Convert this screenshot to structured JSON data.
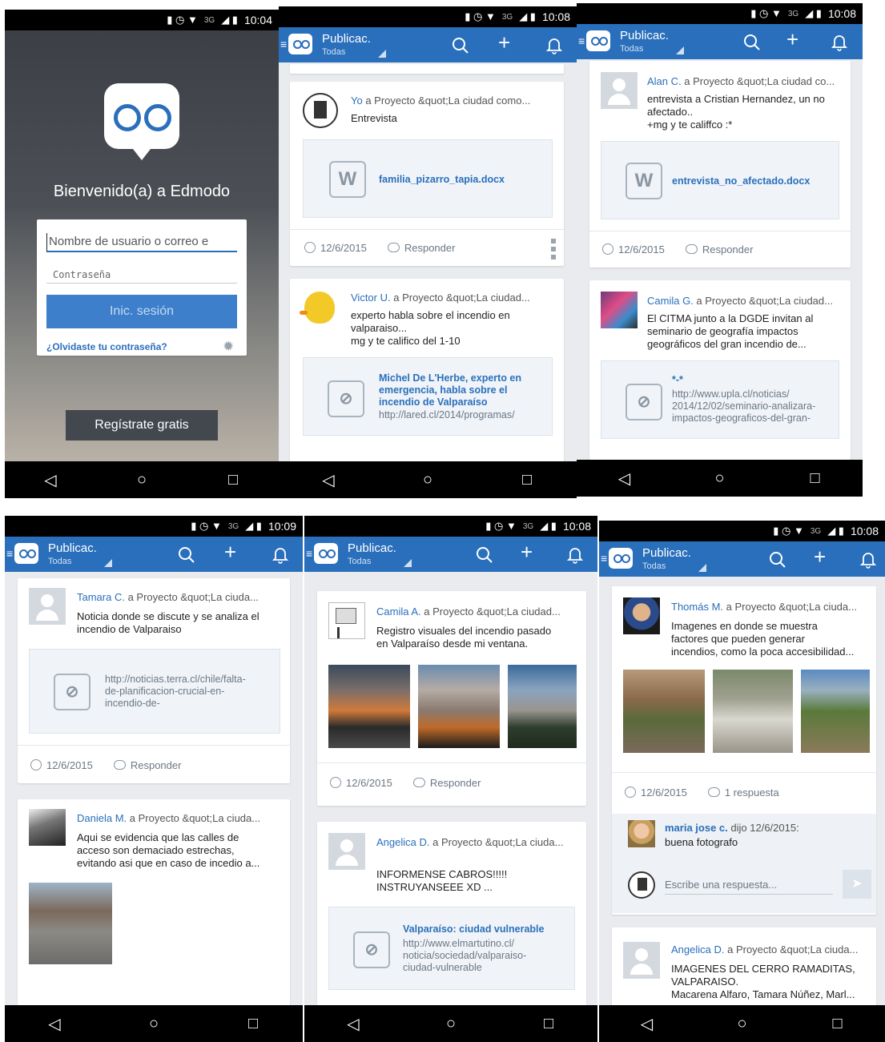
{
  "status": {
    "times": [
      "10:04",
      "10:08",
      "10:08",
      "10:09",
      "10:08",
      "10:08"
    ],
    "network": "3G"
  },
  "appbar": {
    "title": "Publicac.",
    "filter": "Todas"
  },
  "login": {
    "welcome": "Bienvenido(a) a Edmodo",
    "username_placeholder": "Nombre de usuario o correo e",
    "password_placeholder": "Contraseña",
    "signin": "Inic. sesión",
    "forgot": "¿Olvidaste tu contraseña?",
    "register": "Regístrate gratis"
  },
  "common": {
    "date": "12/6/2015",
    "reply": "Responder",
    "one_reply": "1 respuesta",
    "reply_placeholder": "Escribe una respuesta..."
  },
  "s2": {
    "p1": {
      "author": "Yo",
      "group": "a Proyecto &quot;La ciudad como...",
      "text": "Entrevista",
      "file": "familia_pizarro_tapia.docx"
    },
    "p2": {
      "author": "Victor U.",
      "group": "a Proyecto &quot;La ciudad...",
      "text": "experto habla sobre el incendio en\nvalparaiso...\nmg y te califico del 1-10",
      "link_title": "Michel De L'Herbe, experto en\nemergencia, habla sobre el\nincendio de Valparaíso",
      "link_url": "http://lared.cl/2014/programas/"
    }
  },
  "s3": {
    "p1": {
      "author": "Alan C.",
      "group": "a Proyecto &quot;La ciudad co...",
      "text": "entrevista a Cristian Hernandez, un no\nafectado..\n+mg y te califfco :*",
      "file": "entrevista_no_afectado.docx"
    },
    "p2": {
      "author": "Camila G.",
      "group": "a Proyecto &quot;La ciudad...",
      "text": "El CITMA junto a la DGDE invitan al\nseminario de geografía impactos\ngeográficos del gran incendio de...",
      "link_title": "*-*",
      "link_url": "http://www.upla.cl/noticias/\n2014/12/02/seminario-analizara-\nimpactos-geograficos-del-gran-"
    }
  },
  "s4": {
    "p1": {
      "author": "Tamara C.",
      "group": "a Proyecto &quot;La ciuda...",
      "text": "Noticia donde se discute y se analiza el\nincendio de Valparaiso",
      "link_url": "http://noticias.terra.cl/chile/falta-\nde-planificacion-crucial-en-\nincendio-de-"
    },
    "p2": {
      "author": "Daniela M.",
      "group": "a Proyecto &quot;La ciuda...",
      "text": "Aqui se evidencia que las calles de\nacceso son demaciado estrechas,\nevitando asi que en caso de incedio a..."
    }
  },
  "s5": {
    "p1": {
      "author": "Camila A.",
      "group": "a Proyecto &quot;La ciudad...",
      "text": "Registro visuales del incendio pasado\nen Valparaíso desde mi ventana."
    },
    "p2": {
      "author": "Angelica D.",
      "group": "a Proyecto &quot;La ciuda...",
      "text": "INFORMENSE CABROS!!!!!\nINSTRUYANSEEE XD ...",
      "link_title": "Valparaíso: ciudad vulnerable",
      "link_url": "http://www.elmartutino.cl/\nnoticia/sociedad/valparaiso-\nciudad-vulnerable"
    }
  },
  "s6": {
    "p1": {
      "author": "Thomás M.",
      "group": "a Proyecto &quot;La ciuda...",
      "text": "Imagenes en donde se muestra\nfactores que pueden generar\nincendios, como la poca accesibilidad...",
      "comment_author": "maria jose c.",
      "comment_meta": "dijo 12/6/2015:",
      "comment_text": "buena fotografo"
    },
    "p2": {
      "author": "Angelica D.",
      "group": "a Proyecto &quot;La ciuda...",
      "text": "IMAGENES DEL CERRO RAMADITAS,\nVALPARAISO.\nMacarena Alfaro, Tamara Núñez, Marl..."
    }
  },
  "colors": {
    "brand": "#2a6fbb",
    "button": "#3d7fcb",
    "background": "#e9ebee"
  }
}
